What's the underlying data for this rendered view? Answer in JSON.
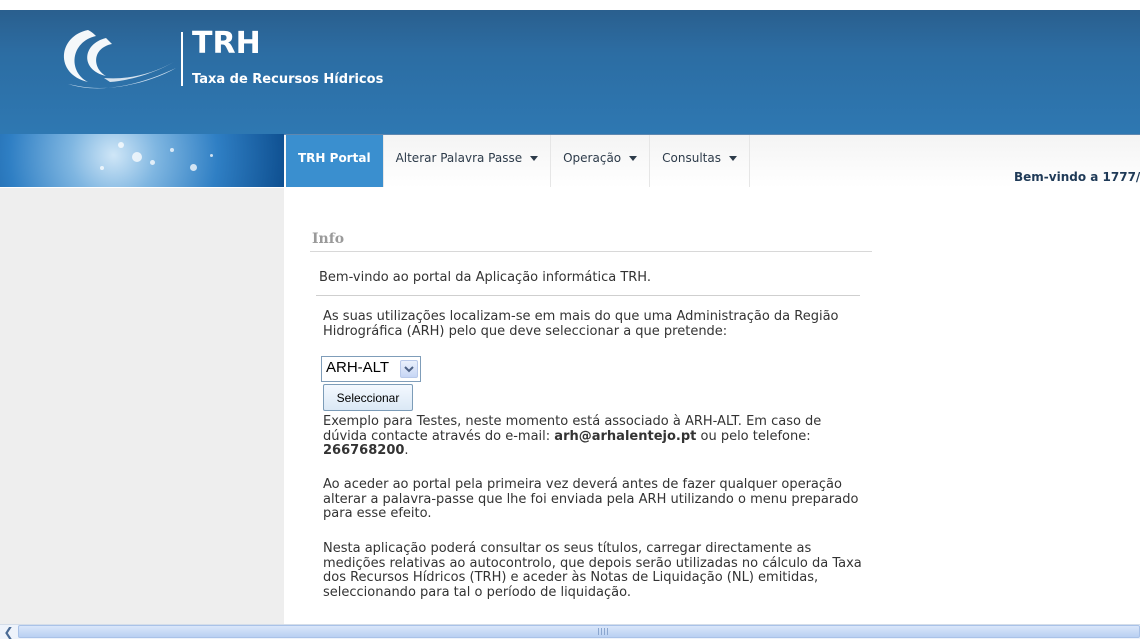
{
  "header": {
    "title": "TRH",
    "subtitle": "Taxa de Recursos Hídricos",
    "accent_color": "#2e78b2"
  },
  "nav": {
    "items": [
      {
        "label": "TRH Portal",
        "active": true,
        "dropdown": false
      },
      {
        "label": "Alterar Palavra Passe",
        "active": false,
        "dropdown": true
      },
      {
        "label": "Operação",
        "active": false,
        "dropdown": true
      },
      {
        "label": "Consultas",
        "active": false,
        "dropdown": true
      }
    ],
    "welcome": "Bem-vindo a 1777/"
  },
  "content": {
    "heading": "Info",
    "intro": "Bem-vindo ao portal da Aplicação informática TRH.",
    "para1": "As suas utilizações localizam-se em mais do que uma Administração da Região Hidrográfica (ARH) pelo que deve seleccionar a que pretende:",
    "arh_select": {
      "value": "ARH-ALT"
    },
    "select_button": "Seleccionar",
    "para2_pre": "Exemplo para Testes, neste momento está associado à ARH-ALT. Em caso de dúvida contacte através do e-mail: ",
    "para2_email": "arh@arhalentejo.pt",
    "para2_mid": " ou pelo telefone: ",
    "para2_phone": "266768200",
    "para2_end": ".",
    "para3": "Ao aceder ao portal pela primeira vez deverá antes de fazer qualquer operação alterar a palavra-passe que lhe foi enviada pela ARH utilizando o menu preparado para esse efeito.",
    "para4": "Nesta aplicação poderá consultar os seus títulos, carregar directamente as medições relativas ao autocontrolo, que depois serão utilizadas no cálculo da Taxa dos Recursos Hídricos (TRH) e aceder às Notas de Liquidação (NL) emitidas, seleccionando para tal o período de liquidação."
  },
  "icons": {
    "logo": "wave-logo-icon",
    "dropdown": "caret-down-icon",
    "scroll_left": "scroll-left-arrow-icon"
  }
}
